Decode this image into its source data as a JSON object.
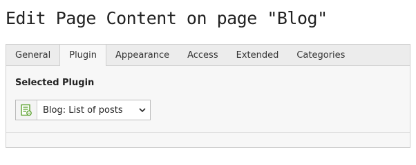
{
  "page": {
    "title": "Edit Page Content on page \"Blog\""
  },
  "tabs": [
    {
      "label": "General"
    },
    {
      "label": "Plugin",
      "active": true
    },
    {
      "label": "Appearance"
    },
    {
      "label": "Access"
    },
    {
      "label": "Extended"
    },
    {
      "label": "Categories"
    }
  ],
  "plugin_panel": {
    "section_label": "Selected Plugin",
    "select": {
      "value": "Blog: List of posts",
      "icon": "plugin-list-icon",
      "dropdown_icon": "chevron-down-icon"
    }
  },
  "colors": {
    "accent_green": "#5aa02c",
    "tab_bar": "#ececec",
    "panel_bg": "#f7f7f7"
  }
}
